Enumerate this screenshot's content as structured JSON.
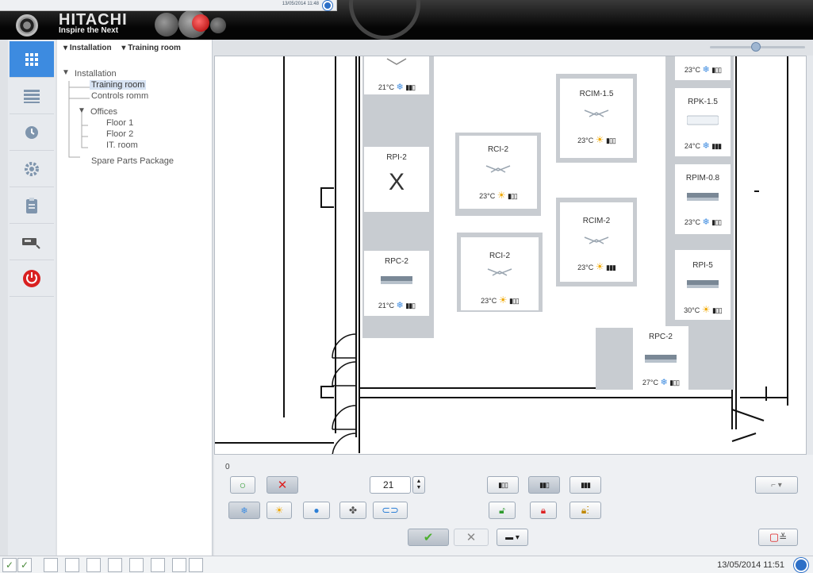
{
  "header": {
    "brand": "HITACHI",
    "tagline": "Inspire the Next",
    "popup_datetime": "13/05/2014 11:48"
  },
  "breadcrumb": [
    {
      "label": "Installation"
    },
    {
      "label": "Training room"
    }
  ],
  "nav": [
    {
      "icon": "grid-icon",
      "active": true
    },
    {
      "icon": "list-icon"
    },
    {
      "icon": "clock-icon"
    },
    {
      "icon": "gear-icon"
    },
    {
      "icon": "clipboard-icon"
    },
    {
      "icon": "controller-icon"
    },
    {
      "icon": "power-icon"
    }
  ],
  "tree": [
    {
      "label": "Installation"
    },
    {
      "label": "Training room"
    },
    {
      "label": "Controls romm"
    },
    {
      "label": "Offices"
    },
    {
      "label": "Floor 1"
    },
    {
      "label": "Floor 2"
    },
    {
      "label": "IT. room"
    },
    {
      "label": "Spare Parts Package"
    }
  ],
  "units": [
    {
      "name": "",
      "temp": "21°C",
      "mode": "cool"
    },
    {
      "name": "RPI-2",
      "status": "X"
    },
    {
      "name": "RPC-2",
      "temp": "21°C",
      "mode": "cool"
    },
    {
      "name": "RCI-2",
      "temp": "23°C",
      "mode": "heat"
    },
    {
      "name": "RCI-2",
      "temp": "23°C",
      "mode": "heat"
    },
    {
      "name": "RCIM-1.5",
      "temp": "23°C",
      "mode": "heat"
    },
    {
      "name": "RCIM-2",
      "temp": "23°C",
      "mode": "heat"
    },
    {
      "name": "",
      "temp": "23°C",
      "mode": "cool"
    },
    {
      "name": "RPK-1.5",
      "temp": "24°C",
      "mode": "cool"
    },
    {
      "name": "RPIM-0.8",
      "temp": "23°C",
      "mode": "cool"
    },
    {
      "name": "RPI-5",
      "temp": "30°C",
      "mode": "heat"
    },
    {
      "name": "RPC-2",
      "temp": "27°C",
      "mode": "cool"
    }
  ],
  "controls": {
    "label": "0",
    "setpoint": "21"
  },
  "status": {
    "datetime": "13/05/2014 11:51"
  }
}
